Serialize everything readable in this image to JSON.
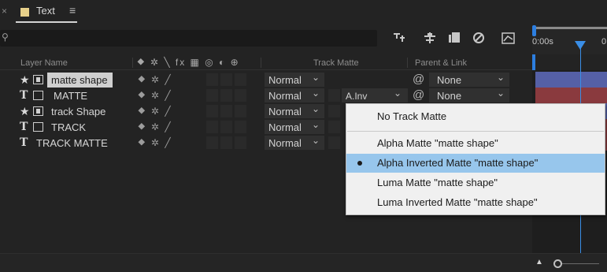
{
  "tab": {
    "close": "×",
    "label": "Text",
    "menu": "≡",
    "swatch": "#e7d08a"
  },
  "search": {
    "icon": "⚲"
  },
  "toolbar": {
    "icons": [
      "draft-3d-icon",
      "shy-icon",
      "frame-blend-icon",
      "motion-blur-icon",
      "graph-editor-icon"
    ]
  },
  "timeline": {
    "ruler_start": "0:00s",
    "ruler_next": "0"
  },
  "columns": {
    "layer_name": "Layer Name",
    "switch_icons": "⯁ ✲ ╲ fx ▦ ◎ ◐ ⊕",
    "track_matte": "Track Matte",
    "parent_link": "Parent & Link"
  },
  "layers": [
    {
      "type": "shape",
      "glyph": "★",
      "name": "matte shape",
      "selected": true,
      "mode": "Normal",
      "track_matte": "",
      "parent": "None",
      "bar": "#5560a6"
    },
    {
      "type": "text",
      "glyph": "T",
      "name": "MATTE",
      "selected": false,
      "mode": "Normal",
      "track_matte": "A.Inv",
      "parent": "None",
      "bar": "#8a3a3e"
    },
    {
      "type": "shape",
      "glyph": "★",
      "name": "track Shape",
      "selected": false,
      "mode": "Normal",
      "track_matte": "",
      "parent": "",
      "bar": "#5560a6"
    },
    {
      "type": "text",
      "glyph": "T",
      "name": "TRACK",
      "selected": false,
      "mode": "Normal",
      "track_matte": "",
      "parent": "",
      "bar": "#8a3a3e"
    },
    {
      "type": "text",
      "glyph": "T",
      "name": "TRACK MATTE",
      "selected": false,
      "mode": "Normal",
      "track_matte": "",
      "parent": "",
      "bar": "#8a3a3e"
    }
  ],
  "layer_switch_glyphs": "⯁ ✲ ╱",
  "dropdown_arrow": "⌄",
  "pickwhip": "@",
  "menu": {
    "items": [
      {
        "label": "No Track Matte",
        "active": false
      },
      {
        "label": "Alpha Matte \"matte shape\"",
        "active": false
      },
      {
        "label": "Alpha Inverted Matte \"matte shape\"",
        "active": true
      },
      {
        "label": "Luma Matte \"matte shape\"",
        "active": false
      },
      {
        "label": "Luma Inverted Matte \"matte shape\"",
        "active": false
      }
    ]
  },
  "colors": {
    "accent": "#2d7fe0",
    "menu_highlight": "#97c6ec",
    "shape_label": "#5560a6",
    "text_label": "#8a3a3e"
  },
  "zoom": {
    "icon": "mountain-icon"
  }
}
